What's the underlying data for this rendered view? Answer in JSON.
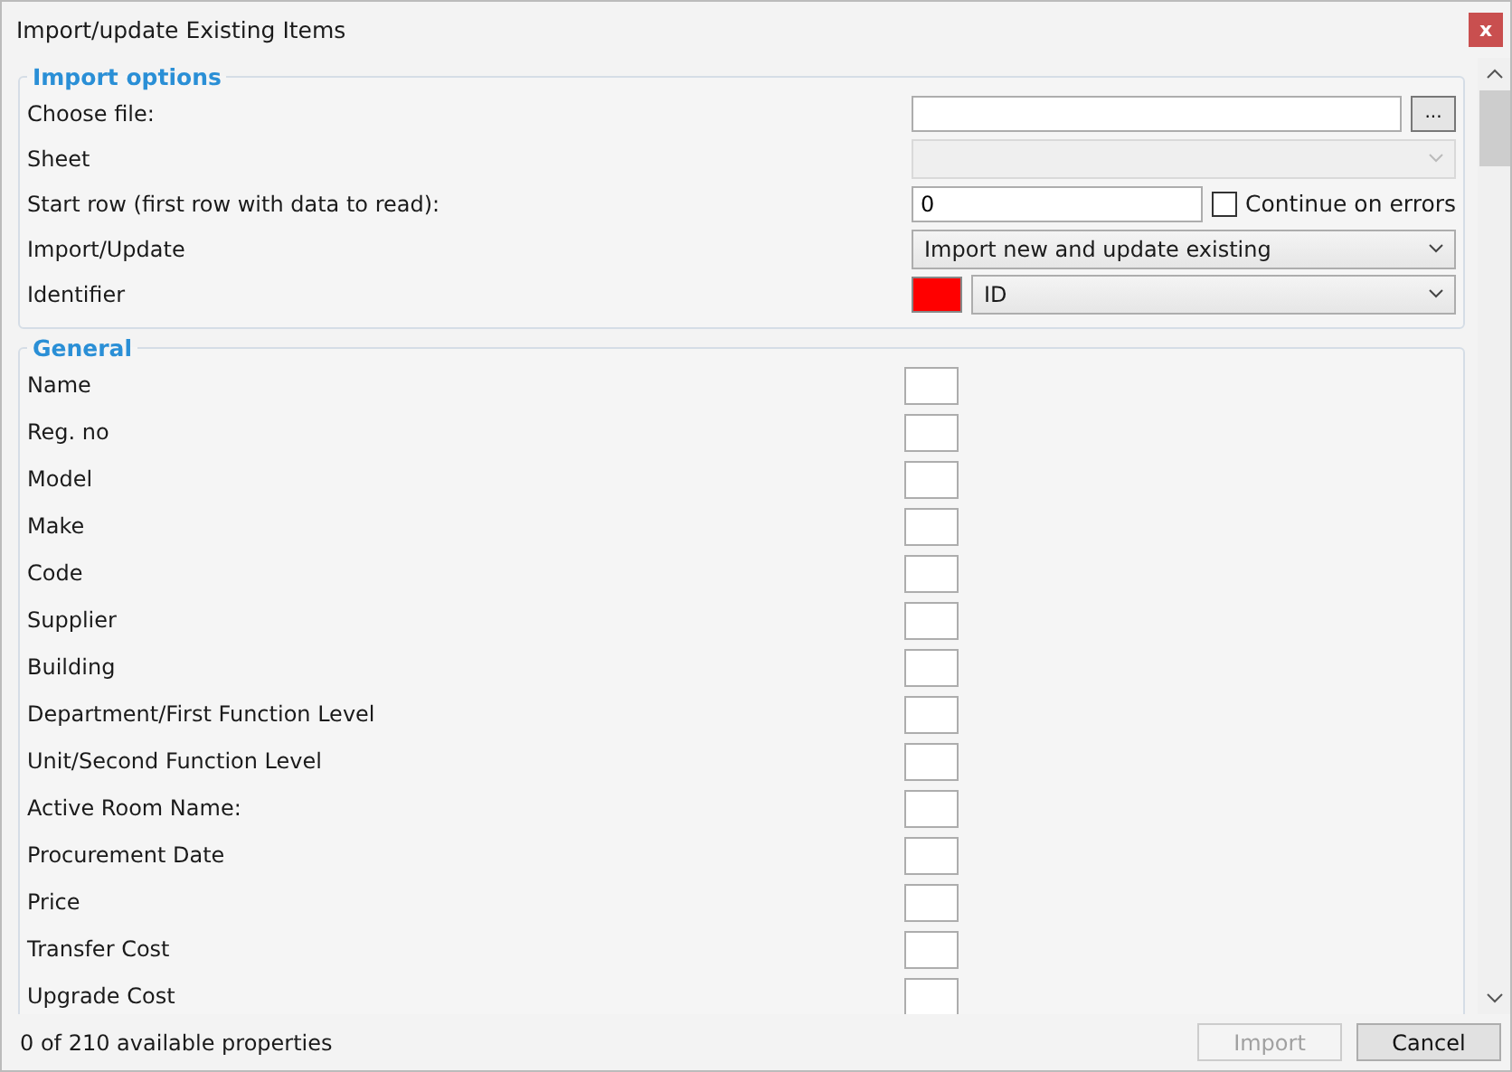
{
  "window": {
    "title": "Import/update Existing Items",
    "close_label": "x"
  },
  "import_options": {
    "legend": "Import options",
    "choose_file": {
      "label": "Choose file:",
      "browse_label": "..."
    },
    "sheet": {
      "label": "Sheet",
      "disabled": true
    },
    "start_row": {
      "label": "Start row (first row with data to read):",
      "value": "0"
    },
    "continue_on_errors": {
      "label": "Continue on errors",
      "checked": false
    },
    "import_update": {
      "label": "Import/Update",
      "value": "Import new and update existing"
    },
    "identifier": {
      "label": "Identifier",
      "color": "#ff0000",
      "value": "ID"
    }
  },
  "general": {
    "legend": "General",
    "fields": [
      {
        "label": "Name"
      },
      {
        "label": "Reg. no"
      },
      {
        "label": "Model"
      },
      {
        "label": "Make"
      },
      {
        "label": "Code"
      },
      {
        "label": "Supplier"
      },
      {
        "label": "Building"
      },
      {
        "label": "Department/First Function Level"
      },
      {
        "label": "Unit/Second Function Level"
      },
      {
        "label": "Active Room Name:"
      },
      {
        "label": "Procurement Date"
      },
      {
        "label": "Price"
      },
      {
        "label": "Transfer Cost"
      },
      {
        "label": "Upgrade Cost"
      }
    ]
  },
  "status": "0 of 210 available properties",
  "buttons": [
    {
      "label": "Import",
      "disabled": true
    },
    {
      "label": "Cancel",
      "disabled": false
    }
  ]
}
